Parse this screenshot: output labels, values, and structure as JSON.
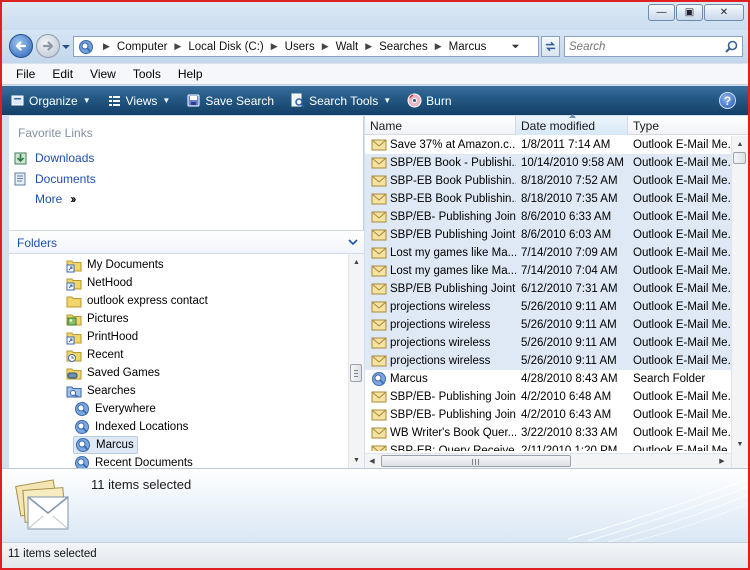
{
  "address": {
    "crumbs": [
      "Computer",
      "Local Disk (C:)",
      "Users",
      "Walt",
      "Searches",
      "Marcus"
    ],
    "search_placeholder": "Search"
  },
  "menu": [
    "File",
    "Edit",
    "View",
    "Tools",
    "Help"
  ],
  "commands": {
    "organize": "Organize",
    "views": "Views",
    "save_search": "Save Search",
    "search_tools": "Search Tools",
    "burn": "Burn",
    "help": "?"
  },
  "favorites": {
    "title": "Favorite Links",
    "items": [
      "Downloads",
      "Documents"
    ],
    "more": "More"
  },
  "folders": {
    "title": "Folders",
    "items": [
      {
        "label": "My Documents",
        "icon": "shortcut-folder-icon"
      },
      {
        "label": "NetHood",
        "icon": "shortcut-folder-icon"
      },
      {
        "label": "outlook express contact",
        "icon": "folder-icon"
      },
      {
        "label": "Pictures",
        "icon": "pictures-folder-icon"
      },
      {
        "label": "PrintHood",
        "icon": "shortcut-folder-icon"
      },
      {
        "label": "Recent",
        "icon": "recent-folder-icon"
      },
      {
        "label": "Saved Games",
        "icon": "saved-games-icon"
      },
      {
        "label": "Searches",
        "icon": "searches-folder-icon"
      },
      {
        "label": "Everywhere",
        "icon": "search-folder-icon"
      },
      {
        "label": "Indexed Locations",
        "icon": "search-folder-icon"
      },
      {
        "label": "Marcus",
        "icon": "search-folder-icon"
      },
      {
        "label": "Recent Documents",
        "icon": "search-folder-icon"
      }
    ]
  },
  "columns": {
    "name": "Name",
    "date": "Date modified",
    "type": "Type"
  },
  "files": [
    {
      "name": "Save 37% at Amazon.c...",
      "date": "1/8/2011 7:14 AM",
      "type": "Outlook E-Mail Me...",
      "icon": "mail-icon",
      "selected": false
    },
    {
      "name": "SBP/EB Book - Publishi...",
      "date": "10/14/2010 9:58 AM",
      "type": "Outlook E-Mail Me...",
      "icon": "mail-icon",
      "selected": true
    },
    {
      "name": "SBP-EB Book Publishin...",
      "date": "8/18/2010 7:52 AM",
      "type": "Outlook E-Mail Me...",
      "icon": "mail-icon",
      "selected": true
    },
    {
      "name": "SBP-EB Book Publishin...",
      "date": "8/18/2010 7:35 AM",
      "type": "Outlook E-Mail Me...",
      "icon": "mail-icon",
      "selected": true
    },
    {
      "name": "SBP/EB- Publishing Joint...",
      "date": "8/6/2010 6:33 AM",
      "type": "Outlook E-Mail Me...",
      "icon": "mail-icon",
      "selected": true
    },
    {
      "name": "SBP/EB Publishing Joint...",
      "date": "8/6/2010 6:03 AM",
      "type": "Outlook E-Mail Me...",
      "icon": "mail-icon",
      "selected": true
    },
    {
      "name": "Lost my games like Ma...",
      "date": "7/14/2010 7:09 AM",
      "type": "Outlook E-Mail Me...",
      "icon": "mail-icon",
      "selected": true
    },
    {
      "name": "Lost my games like Ma...",
      "date": "7/14/2010 7:04 AM",
      "type": "Outlook E-Mail Me...",
      "icon": "mail-icon",
      "selected": true
    },
    {
      "name": "SBP/EB Publishing Joint...",
      "date": "6/12/2010 7:31 AM",
      "type": "Outlook E-Mail Me...",
      "icon": "mail-icon",
      "selected": true
    },
    {
      "name": "projections wireless",
      "date": "5/26/2010 9:11 AM",
      "type": "Outlook E-Mail Me...",
      "icon": "mail-icon",
      "selected": true
    },
    {
      "name": "projections wireless",
      "date": "5/26/2010 9:11 AM",
      "type": "Outlook E-Mail Me...",
      "icon": "mail-icon",
      "selected": true
    },
    {
      "name": "projections wireless",
      "date": "5/26/2010 9:11 AM",
      "type": "Outlook E-Mail Me...",
      "icon": "mail-icon",
      "selected": true
    },
    {
      "name": "projections wireless",
      "date": "5/26/2010 9:11 AM",
      "type": "Outlook E-Mail Me...",
      "icon": "mail-icon",
      "selected": true
    },
    {
      "name": "Marcus",
      "date": "4/28/2010 8:43 AM",
      "type": "Search Folder",
      "icon": "search-folder-icon",
      "selected": false
    },
    {
      "name": "SBP/EB- Publishing Join...",
      "date": "4/2/2010 6:48 AM",
      "type": "Outlook E-Mail Me...",
      "icon": "mail-icon",
      "selected": false
    },
    {
      "name": "SBP/EB- Publishing Join...",
      "date": "4/2/2010 6:43 AM",
      "type": "Outlook E-Mail Me...",
      "icon": "mail-icon",
      "selected": false
    },
    {
      "name": "WB Writer's Book Quer...",
      "date": "3/22/2010 8:33 AM",
      "type": "Outlook E-Mail Me...",
      "icon": "mail-icon",
      "selected": false
    },
    {
      "name": "SBP-EB: Query Receive...",
      "date": "2/11/2010 1:20 PM",
      "type": "Outlook E-Mail Me...",
      "icon": "mail-icon",
      "selected": false
    }
  ],
  "details": {
    "text": "11 items selected"
  },
  "status": {
    "text": "11 items selected"
  },
  "colors": {
    "command_bar": "#235883",
    "selection": "#dfe9f5",
    "link": "#1e4fb0"
  }
}
